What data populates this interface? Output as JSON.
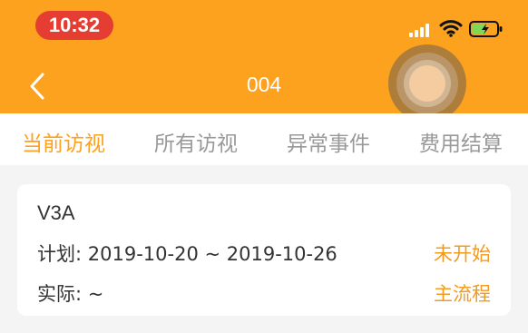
{
  "status_bar": {
    "time": "10:32",
    "time_pill_color": "#e53d31",
    "icons": [
      "cellular-signal-icon",
      "wifi-icon",
      "battery-charging-icon"
    ]
  },
  "header": {
    "title": "004",
    "background": "#fca21f",
    "back_icon": "chevron-left-icon"
  },
  "tabs": [
    {
      "label": "当前访视",
      "active": true
    },
    {
      "label": "所有访视",
      "active": false
    },
    {
      "label": "异常事件",
      "active": false
    },
    {
      "label": "费用结算",
      "active": false
    }
  ],
  "visit_card": {
    "code": "V3A",
    "plan_label": "计划:",
    "plan_value": "2019-10-20 ~ 2019-10-26",
    "actual_label": "实际:",
    "actual_value": "~",
    "status": "未开始",
    "process": "主流程",
    "accent_color": "#f29b1f"
  }
}
